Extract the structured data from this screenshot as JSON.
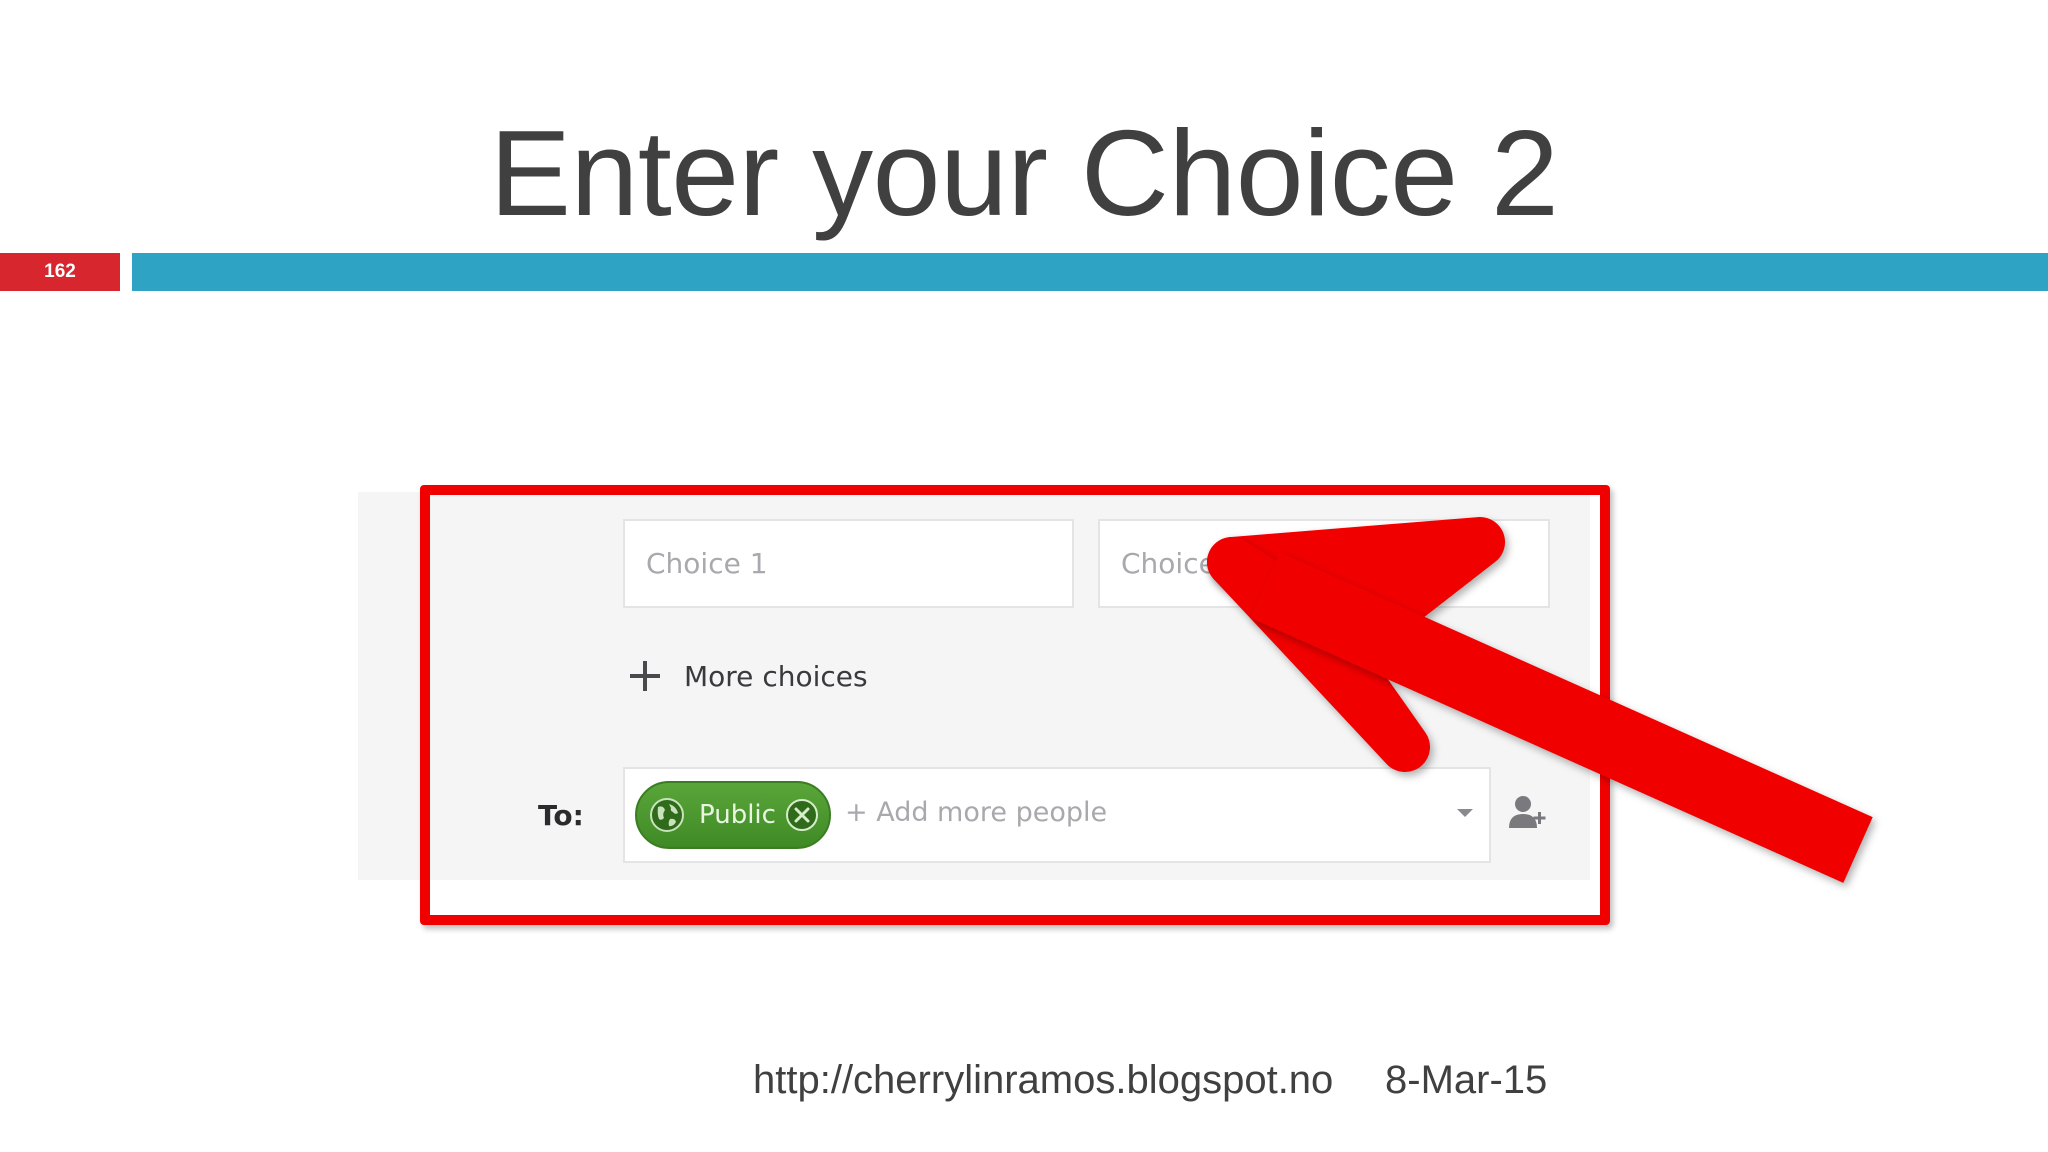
{
  "slide": {
    "title": "Enter your Choice 2",
    "number": "162",
    "footer_url": "http://cherrylinramos.blogspot.no",
    "footer_date": "8-Mar-15"
  },
  "poll_form": {
    "choices": [
      {
        "placeholder": "Choice 1"
      },
      {
        "placeholder": "Choice 2"
      }
    ],
    "more_choices_label": "More choices",
    "to_label": "To:",
    "audience_chip": "Public",
    "add_people_placeholder": "+ Add more people"
  },
  "colors": {
    "title": "#404040",
    "slide_number_bg": "#d7262e",
    "accent_bar": "#2ea3c3",
    "highlight": "#f10000",
    "public_chip": "#4a962d"
  },
  "icons": {
    "more_choices": "plus-icon",
    "chip": "globe-icon",
    "chip_remove": "remove-chip-icon",
    "dropdown": "chevron-down-icon",
    "add_person": "add-person-icon"
  }
}
